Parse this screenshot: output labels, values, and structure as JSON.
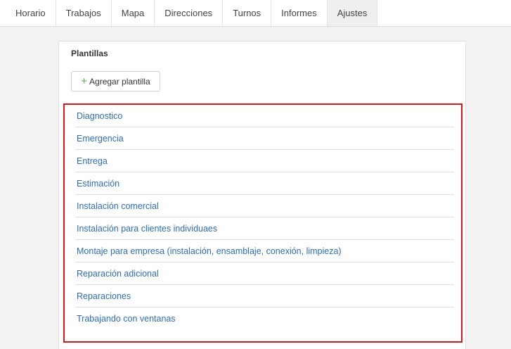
{
  "nav": {
    "tabs": [
      {
        "label": "Horario"
      },
      {
        "label": "Trabajos"
      },
      {
        "label": "Mapa"
      },
      {
        "label": "Direcciones"
      },
      {
        "label": "Turnos"
      },
      {
        "label": "Informes"
      },
      {
        "label": "Ajustes",
        "active": true
      }
    ]
  },
  "panel": {
    "title": "Plantillas",
    "add_button": {
      "icon": "plus-icon",
      "label": "Agregar plantilla"
    },
    "templates": [
      "Diagnostico",
      "Emergencia",
      "Entrega",
      "Estimación",
      "Instalación comercial",
      "Instalación para clientes individuaes",
      "Montaje para empresa (instalación, ensamblaje, conexión, limpieza)",
      "Reparación adicional",
      "Reparaciones",
      "Trabajando con ventanas"
    ]
  },
  "colors": {
    "link": "#2a6ebb",
    "highlight_border": "#e0151b",
    "plus_icon": "#4caf50",
    "active_tab_bg": "#efefef"
  }
}
